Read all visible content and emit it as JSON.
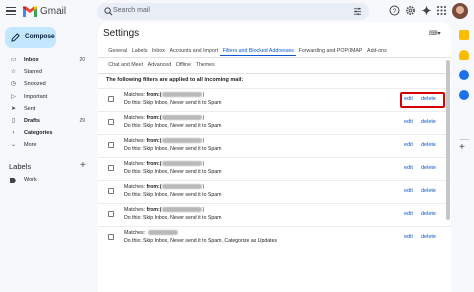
{
  "app": {
    "name": "Gmail"
  },
  "search": {
    "placeholder": "Search mail"
  },
  "compose": {
    "label": "Compose"
  },
  "nav": {
    "items": [
      {
        "label": "Inbox",
        "count": "20",
        "bold": true,
        "icon": "inbox-icon"
      },
      {
        "label": "Starred",
        "count": "",
        "bold": false,
        "icon": "star-icon"
      },
      {
        "label": "Snoozed",
        "count": "",
        "bold": false,
        "icon": "clock-icon"
      },
      {
        "label": "Important",
        "count": "",
        "bold": false,
        "icon": "label-important-icon"
      },
      {
        "label": "Sent",
        "count": "",
        "bold": false,
        "icon": "send-icon"
      },
      {
        "label": "Drafts",
        "count": "29",
        "bold": true,
        "icon": "draft-icon"
      },
      {
        "label": "Categories",
        "count": "",
        "bold": true,
        "icon": "chevron-right-icon"
      },
      {
        "label": "More",
        "count": "",
        "bold": false,
        "icon": "chevron-down-icon"
      }
    ]
  },
  "labels": {
    "heading": "Labels",
    "items": [
      {
        "label": "Work"
      }
    ]
  },
  "settings": {
    "title": "Settings",
    "tabs_row1": [
      "General",
      "Labels",
      "Inbox",
      "Accounts and Import",
      "Filters and Blocked Addresses",
      "Forwarding and POP/IMAP",
      "Add-ons"
    ],
    "tabs_row2": [
      "Chat and Meet",
      "Advanced",
      "Offline",
      "Themes"
    ],
    "active_tab": "Filters and Blocked Addresses",
    "filters_heading": "The following filters are applied to all incoming mail:",
    "filters": [
      {
        "matches": "Matches:",
        "from": "from:(",
        "close": ")",
        "action": "Do this: Skip Inbox, Never send it to Spam"
      },
      {
        "matches": "Matches:",
        "from": "from:(",
        "close": ")",
        "action": "Do this: Skip Inbox, Never send it to Spam"
      },
      {
        "matches": "Matches:",
        "from": "from:(",
        "close": ")",
        "action": "Do this: Skip Inbox, Never send it to Spam"
      },
      {
        "matches": "Matches:",
        "from": "from:(",
        "close": ")",
        "action": "Do this: Skip Inbox, Never send it to Spam"
      },
      {
        "matches": "Matches:",
        "from": "from:(",
        "close": ")",
        "action": "Do this: Skip Inbox, Never send it to Spam"
      },
      {
        "matches": "Matches:",
        "from": "from:(",
        "close": ")",
        "action": "Do this: Skip Inbox, Never send it to Spam"
      },
      {
        "matches": "Matches:",
        "from": "",
        "close": "",
        "action": "Do this: Skip Inbox, Never send it to Spam, Categorize as Updates"
      }
    ],
    "edit_label": "edit",
    "delete_label": "delete"
  },
  "colors": {
    "accent": "#0b57d0",
    "compose_bg": "#c2e7ff",
    "highlight": "#d50000"
  }
}
